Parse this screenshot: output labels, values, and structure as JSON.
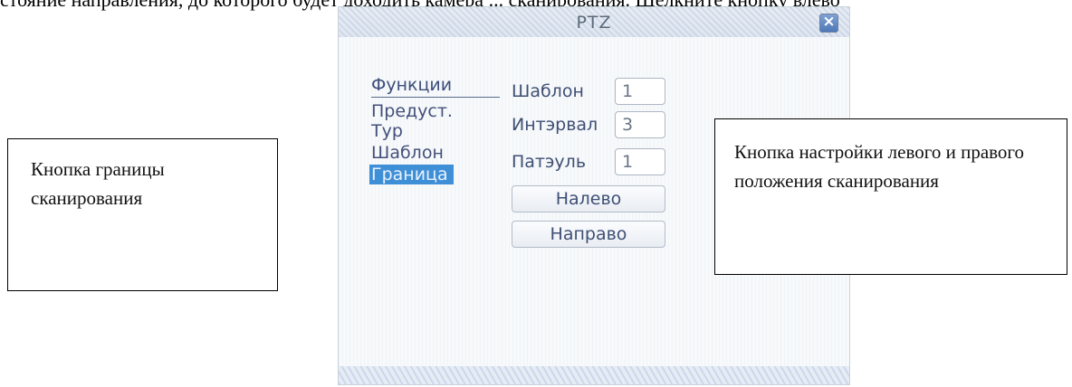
{
  "doc": {
    "top_line": "стояние направления, до которого будет доходить камера ... сканирования. Щелкните кнопку влево"
  },
  "callouts": {
    "left": "Кнопка границы сканирования",
    "right": "Кнопка настройки левого и правого положения сканирования"
  },
  "dialog": {
    "title": "PTZ",
    "close_icon": "close-icon",
    "menu_header": "Функции",
    "menu_items": [
      "Предуст.",
      "Тур",
      "Шаблон",
      "Граница"
    ],
    "selected_menu": "Граница",
    "fields": {
      "template_label": "Шаблон",
      "template_value": "1",
      "interval_label": "Интэрвал",
      "interval_value": "3",
      "patrol_label": "Патэуль",
      "patrol_value": "1"
    },
    "buttons": {
      "left": "Налево",
      "right": "Направо"
    },
    "colors": {
      "selected_bg": "#3f8fd6",
      "close_bg": "#5f86c4"
    }
  }
}
